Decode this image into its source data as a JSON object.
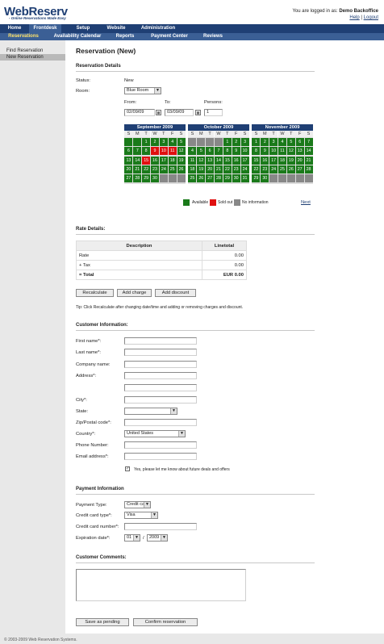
{
  "brand": {
    "name": "WebReserv",
    "tagline": "- Online Reservations Made Easy"
  },
  "login": {
    "text": "You are logged in as:",
    "user": "Demo Backoffice",
    "help": "Help",
    "sep": "|",
    "logout": "Logout"
  },
  "nav1": [
    "Home",
    "Frontdesk",
    "Setup",
    "Website",
    "Administration"
  ],
  "nav2": [
    "Reservations",
    "Availability Calendar",
    "Reports",
    "Payment Center",
    "Reviews"
  ],
  "side": [
    "Find Reservation",
    "New Reservation"
  ],
  "page_title": "Reservation (New)",
  "details": {
    "heading": "Reservation Details",
    "status_label": "Status:",
    "status_value": "New",
    "room_label": "Room:",
    "room_value": "Blue Room",
    "from_label": "From:",
    "to_label": "To:",
    "persons_label": "Persons:",
    "from_value": "02/09/09",
    "to_value": "03/09/09",
    "persons_value": "1"
  },
  "calendars": [
    {
      "month": "September 2009",
      "days": [
        "S",
        "M",
        "T",
        "W",
        "T",
        "F",
        "S"
      ],
      "cells": [
        [
          "",
          "g"
        ],
        [
          "",
          "g"
        ],
        [
          "1",
          "g"
        ],
        [
          "2",
          "g"
        ],
        [
          "3",
          "g"
        ],
        [
          "4",
          "g"
        ],
        [
          "5",
          "g"
        ],
        [
          "6",
          "g"
        ],
        [
          "7",
          "g"
        ],
        [
          "8",
          "g"
        ],
        [
          "9",
          "r"
        ],
        [
          "10",
          "r"
        ],
        [
          "11",
          "r"
        ],
        [
          "12",
          "g"
        ],
        [
          "13",
          "g"
        ],
        [
          "14",
          "g"
        ],
        [
          "15",
          "r"
        ],
        [
          "16",
          "g"
        ],
        [
          "17",
          "g"
        ],
        [
          "18",
          "g"
        ],
        [
          "19",
          "g"
        ],
        [
          "20",
          "g"
        ],
        [
          "21",
          "g"
        ],
        [
          "22",
          "g"
        ],
        [
          "23",
          "g"
        ],
        [
          "24",
          "g"
        ],
        [
          "25",
          "g"
        ],
        [
          "26",
          "g"
        ],
        [
          "27",
          "g"
        ],
        [
          "28",
          "g"
        ],
        [
          "29",
          "g"
        ],
        [
          "30",
          "g"
        ],
        [
          "",
          "b"
        ],
        [
          "",
          "b"
        ],
        [
          "",
          "b"
        ]
      ]
    },
    {
      "month": "October 2009",
      "days": [
        "S",
        "M",
        "T",
        "W",
        "T",
        "F",
        "S"
      ],
      "cells": [
        [
          "",
          "b"
        ],
        [
          "",
          "b"
        ],
        [
          "",
          "b"
        ],
        [
          "",
          "b"
        ],
        [
          "1",
          "g"
        ],
        [
          "2",
          "g"
        ],
        [
          "3",
          "g"
        ],
        [
          "4",
          "g"
        ],
        [
          "5",
          "g"
        ],
        [
          "6",
          "g"
        ],
        [
          "7",
          "g"
        ],
        [
          "8",
          "g"
        ],
        [
          "9",
          "g"
        ],
        [
          "10",
          "g"
        ],
        [
          "11",
          "g"
        ],
        [
          "12",
          "g"
        ],
        [
          "13",
          "g"
        ],
        [
          "14",
          "g"
        ],
        [
          "15",
          "g"
        ],
        [
          "16",
          "g"
        ],
        [
          "17",
          "g"
        ],
        [
          "18",
          "g"
        ],
        [
          "19",
          "g"
        ],
        [
          "20",
          "g"
        ],
        [
          "21",
          "g"
        ],
        [
          "22",
          "g"
        ],
        [
          "23",
          "g"
        ],
        [
          "24",
          "g"
        ],
        [
          "25",
          "g"
        ],
        [
          "26",
          "g"
        ],
        [
          "27",
          "g"
        ],
        [
          "28",
          "g"
        ],
        [
          "29",
          "g"
        ],
        [
          "30",
          "g"
        ],
        [
          "31",
          "g"
        ]
      ]
    },
    {
      "month": "November 2009",
      "days": [
        "S",
        "M",
        "T",
        "W",
        "T",
        "F",
        "S"
      ],
      "cells": [
        [
          "1",
          "g"
        ],
        [
          "2",
          "g"
        ],
        [
          "3",
          "g"
        ],
        [
          "4",
          "g"
        ],
        [
          "5",
          "g"
        ],
        [
          "6",
          "g"
        ],
        [
          "7",
          "g"
        ],
        [
          "8",
          "g"
        ],
        [
          "9",
          "g"
        ],
        [
          "10",
          "g"
        ],
        [
          "11",
          "g"
        ],
        [
          "12",
          "g"
        ],
        [
          "13",
          "g"
        ],
        [
          "14",
          "g"
        ],
        [
          "15",
          "g"
        ],
        [
          "16",
          "g"
        ],
        [
          "17",
          "g"
        ],
        [
          "18",
          "g"
        ],
        [
          "19",
          "g"
        ],
        [
          "20",
          "g"
        ],
        [
          "21",
          "g"
        ],
        [
          "22",
          "g"
        ],
        [
          "23",
          "g"
        ],
        [
          "24",
          "g"
        ],
        [
          "25",
          "g"
        ],
        [
          "26",
          "g"
        ],
        [
          "27",
          "g"
        ],
        [
          "28",
          "g"
        ],
        [
          "29",
          "g"
        ],
        [
          "30",
          "g"
        ],
        [
          "",
          "b"
        ],
        [
          "",
          "b"
        ],
        [
          "",
          "b"
        ],
        [
          "",
          "b"
        ],
        [
          "",
          "b"
        ]
      ]
    }
  ],
  "legend": {
    "available": "Available",
    "sold_out": "Sold out",
    "no_info": "No information",
    "next": "Next"
  },
  "colors": {
    "available": "#1a7a1a",
    "sold_out": "#e01010",
    "no_info": "#888888",
    "nav": "#1f3f74"
  },
  "rate": {
    "heading": "Rate Details:",
    "col_desc": "Description",
    "col_total": "Linetotal",
    "rows": [
      [
        "Rate",
        "0.00"
      ],
      [
        "+ Tax",
        "0.00"
      ],
      [
        "= Total",
        "EUR 0.00"
      ]
    ]
  },
  "buttons": {
    "recalc": "Recalculate",
    "add_charge": "Add charge",
    "add_discount": "Add discount",
    "save_pending": "Save as pending",
    "confirm": "Confirm reservation"
  },
  "tip": "Tip: Click Recalculate after changing date/time and adding or removing charges and discount.",
  "customer": {
    "heading": "Customer Information:",
    "fields": [
      "First name*:",
      "Last name*:",
      "Company name:",
      "Address*:",
      "",
      "City*:",
      "State:",
      "Zip/Postal code*:",
      "Country*:",
      "Phone Number:",
      "Email address*:"
    ],
    "country_value": "United States",
    "newsletter": "Yes, please let me know about future deals and offers"
  },
  "payment": {
    "heading": "Payment Information",
    "type_label": "Payment Type:",
    "type_value": "Credit card",
    "cctype_label": "Credit card type*:",
    "cctype_value": "Visa",
    "ccnum_label": "Credit card number*:",
    "exp_label": "Expiration date*:",
    "exp_month": "01",
    "exp_sep": "/",
    "exp_year": "2009"
  },
  "comments": {
    "heading": "Customer Comments:"
  },
  "footer": "© 2003-2009 Web Reservation Systems."
}
